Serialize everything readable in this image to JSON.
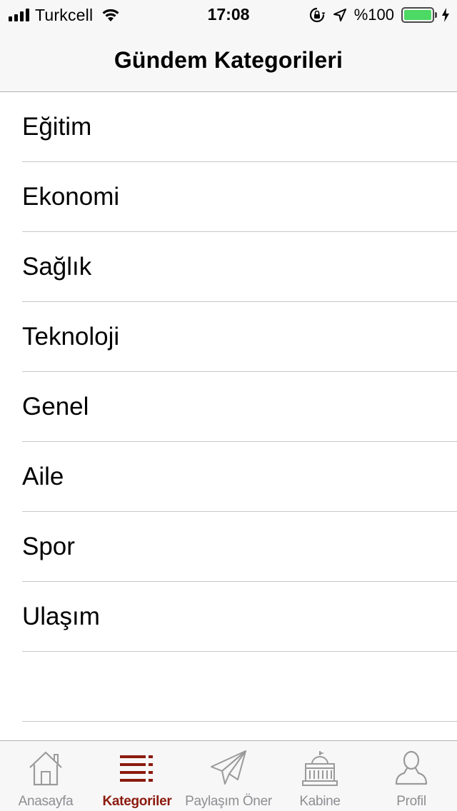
{
  "status_bar": {
    "carrier": "Turkcell",
    "time": "17:08",
    "battery_percent": "%100",
    "battery_level": 1.0,
    "icons": [
      "signal-icon",
      "wifi-icon",
      "orientation-lock-icon",
      "location-icon",
      "battery-icon",
      "charging-icon"
    ]
  },
  "header": {
    "title": "Gündem Kategorileri"
  },
  "categories": [
    {
      "label": "Eğitim"
    },
    {
      "label": "Ekonomi"
    },
    {
      "label": "Sağlık"
    },
    {
      "label": "Teknoloji"
    },
    {
      "label": "Genel"
    },
    {
      "label": "Aile"
    },
    {
      "label": "Spor"
    },
    {
      "label": "Ulaşım"
    },
    {
      "label": ""
    }
  ],
  "tab_bar": {
    "tabs": [
      {
        "label": "Anasayfa",
        "icon": "home-icon",
        "active": false
      },
      {
        "label": "Kategoriler",
        "icon": "list-icon",
        "active": true
      },
      {
        "label": "Paylaşım Öner",
        "icon": "paper-plane-icon",
        "active": false
      },
      {
        "label": "Kabine",
        "icon": "parliament-icon",
        "active": false
      },
      {
        "label": "Profil",
        "icon": "person-icon",
        "active": false
      }
    ],
    "active_color": "#8b1a0e",
    "inactive_color": "#8e8e93"
  }
}
